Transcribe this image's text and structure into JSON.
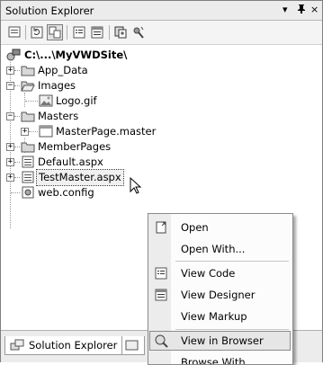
{
  "title": "Solution Explorer",
  "title_buttons": {
    "dropdown": "▾",
    "pin": "ᵖ",
    "close": "×"
  },
  "tree": {
    "root": "C:\\...\\MyVWDSite\\",
    "items": [
      {
        "label": "App_Data"
      },
      {
        "label": "Images"
      },
      {
        "label": "Logo.gif"
      },
      {
        "label": "Masters"
      },
      {
        "label": "MasterPage.master"
      },
      {
        "label": "MemberPages"
      },
      {
        "label": "Default.aspx"
      },
      {
        "label": "TestMaster.aspx"
      },
      {
        "label": "web.config"
      }
    ]
  },
  "context_menu": {
    "items": [
      {
        "label": "Open"
      },
      {
        "label": "Open With..."
      },
      {
        "label": "View Code"
      },
      {
        "label": "View Designer"
      },
      {
        "label": "View Markup"
      },
      {
        "label": "View in Browser"
      },
      {
        "label": "Browse With..."
      }
    ]
  },
  "bottom_tabs": {
    "solution_explorer": "Solution Explorer"
  },
  "colors": {
    "folder": "#d8d8d8",
    "highlight": "#e6e6e6",
    "border": "#808080"
  }
}
